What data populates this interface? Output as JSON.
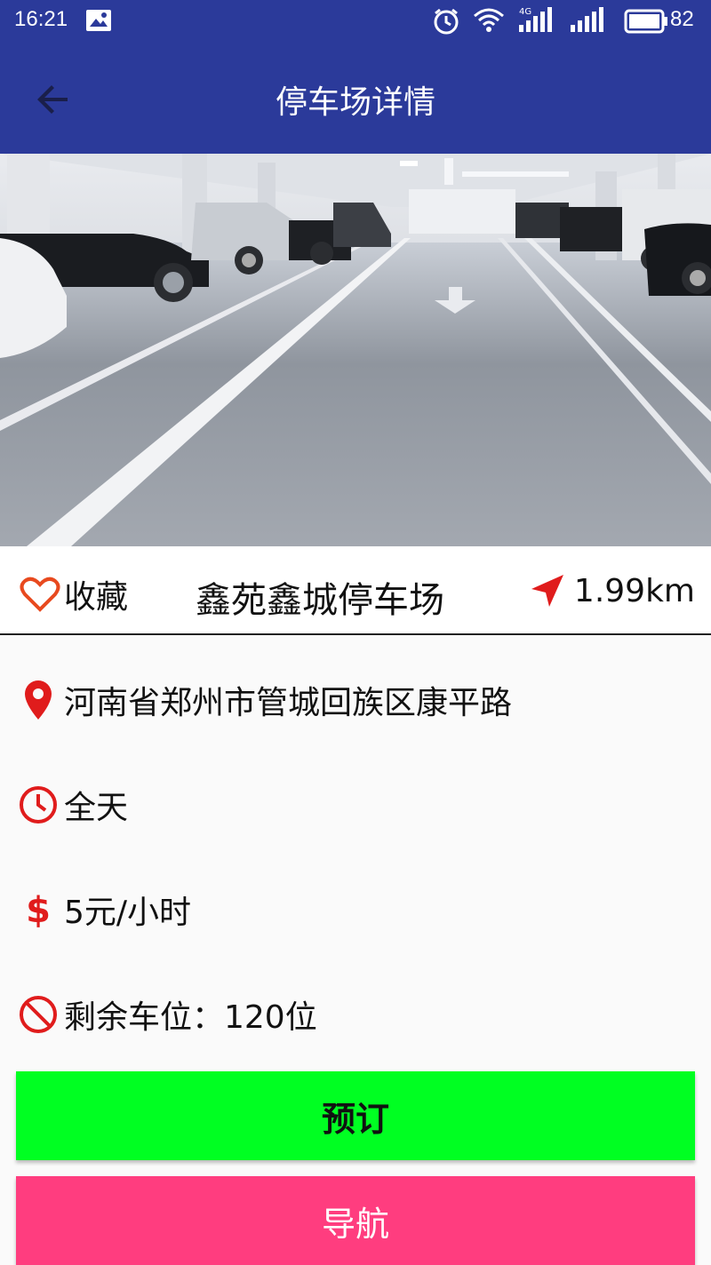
{
  "status_bar": {
    "time": "16:21",
    "battery": "82",
    "network": "4G"
  },
  "app_bar": {
    "title": "停车场详情",
    "back_icon": "arrow-back-icon"
  },
  "hero_image": {
    "subject": "underground-parking-garage-photo"
  },
  "header_row": {
    "favorite_label": "收藏",
    "parking_name": "鑫苑鑫城停车场",
    "distance": "1.99km"
  },
  "details": {
    "address": "河南省郑州市管城回族区康平路",
    "hours": "全天",
    "price": "5元/小时",
    "spaces": "剩余车位：120位"
  },
  "buttons": {
    "book_label": "预订",
    "navigate_label": "导航"
  },
  "colors": {
    "app_bar": "#2b3a9a",
    "accent_red": "#e01c1c",
    "book_button": "#00ff22",
    "nav_button": "#ff3d7f"
  }
}
